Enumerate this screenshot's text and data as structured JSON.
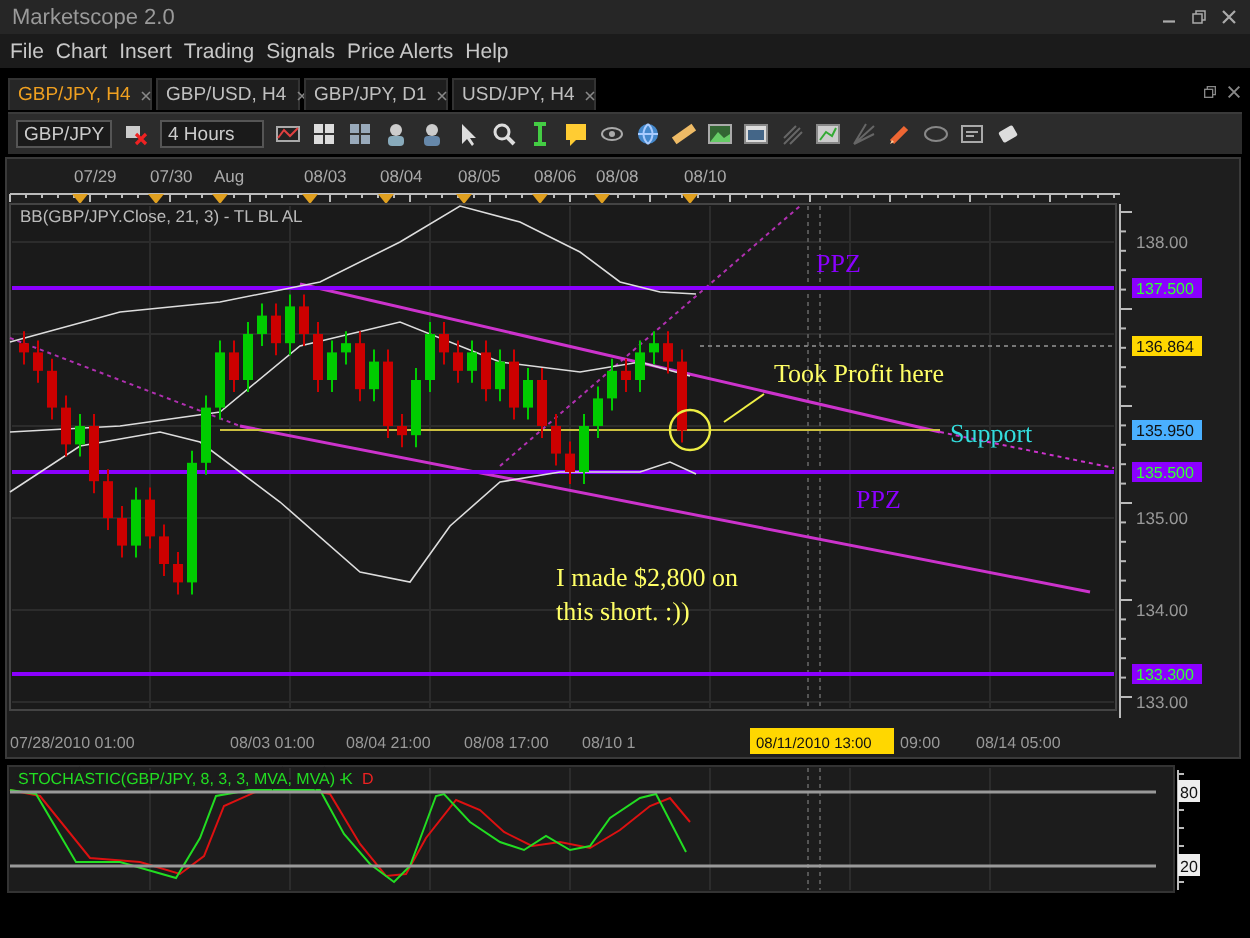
{
  "window": {
    "title": "Marketscope 2.0"
  },
  "menu": [
    "File",
    "Chart",
    "Insert",
    "Trading",
    "Signals",
    "Price Alerts",
    "Help"
  ],
  "tabs": [
    {
      "label": "GBP/JPY, H4",
      "selected": true
    },
    {
      "label": "GBP/USD, H4",
      "selected": false
    },
    {
      "label": "GBP/JPY, D1",
      "selected": false
    },
    {
      "label": "USD/JPY, H4",
      "selected": false
    }
  ],
  "toolbar": {
    "symbol": "GBP/JPY",
    "timeframe": "4 Hours"
  },
  "chart": {
    "date_labels": [
      "07/29",
      "07/30",
      "Aug",
      "08/03",
      "08/04",
      "08/05",
      "08/06",
      "08/08",
      "08/10"
    ],
    "indicator": "BB(GBP/JPY.Close, 21, 3) - TL BL AL",
    "price_ticks": [
      "138.00",
      "135.00",
      "134.00",
      "133.00"
    ],
    "price_markers": [
      {
        "text": "137.500",
        "color": "#8b00ff"
      },
      {
        "text": "136.864",
        "color": "#ffd700"
      },
      {
        "text": "135.950",
        "color": "#4ab0ff"
      },
      {
        "text": "135.500",
        "color": "#8b00ff"
      },
      {
        "text": "133.300",
        "color": "#8b00ff"
      }
    ],
    "annotations": [
      {
        "lines": [
          "PPZ"
        ],
        "color": "#8b00ff"
      },
      {
        "lines": [
          "Took Profit here"
        ],
        "color": "#ffff66"
      },
      {
        "lines": [
          "Support"
        ],
        "color": "#33dddd"
      },
      {
        "lines": [
          "PPZ"
        ],
        "color": "#8b00ff"
      },
      {
        "lines": [
          "I made $2,800 on",
          "this short. :))"
        ],
        "color": "#ffff66"
      }
    ],
    "time_labels": [
      "07/28/2010 01:00",
      "08/03 01:00",
      "08/04 21:00",
      "08/08 17:00",
      "08/10 1",
      "09:00",
      "08/14 05:00"
    ],
    "cursor_label": "08/11/2010 13:00"
  },
  "stochastic": {
    "label": "STOCHASTIC(GBP/JPY, 8, 3, 3, MVA, MVA) -",
    "k": "K",
    "d": "D",
    "levels": [
      "80",
      "20"
    ]
  }
}
